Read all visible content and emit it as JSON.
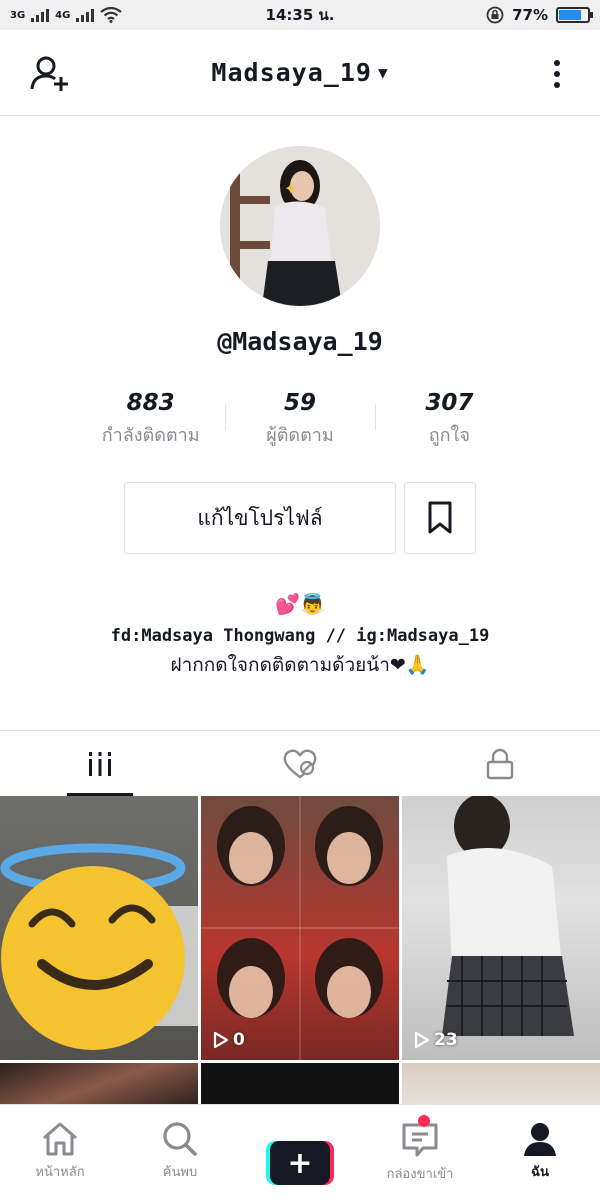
{
  "status_bar": {
    "network_left": "3G",
    "network_right": "4G",
    "time": "14:35 น.",
    "battery_percent": "77%",
    "battery_level": 0.77
  },
  "header": {
    "title": "Madsaya_19"
  },
  "profile": {
    "handle": "@Madsaya_19",
    "stats": [
      {
        "value": "883",
        "label": "กำลังติดตาม"
      },
      {
        "value": "59",
        "label": "ผู้ติดตาม"
      },
      {
        "value": "307",
        "label": "ถูกใจ"
      }
    ],
    "edit_button": "แก้ไขโปรไฟล์",
    "bio_emoji": "💕👼",
    "bio_line1": "fd:Madsaya Thongwang // ig:Madsaya_19",
    "bio_line2": "ฝากกดใจกดติดตามด้วยน้า❤🙏"
  },
  "videos": [
    {
      "views": ""
    },
    {
      "views": "0"
    },
    {
      "views": "23"
    }
  ],
  "bottom_nav": [
    {
      "label": "หน้าหลัก",
      "icon": "home-icon"
    },
    {
      "label": "ค้นพบ",
      "icon": "search-icon"
    },
    {
      "label": "",
      "icon": "plus-icon"
    },
    {
      "label": "กล่องขาเข้า",
      "icon": "inbox-icon"
    },
    {
      "label": "ฉัน",
      "icon": "profile-icon"
    }
  ],
  "colors": {
    "accent": "#fe2c55",
    "cyan": "#25f4ee",
    "text": "#161823",
    "muted": "#8a8b91",
    "battery": "#1e8ef5"
  }
}
